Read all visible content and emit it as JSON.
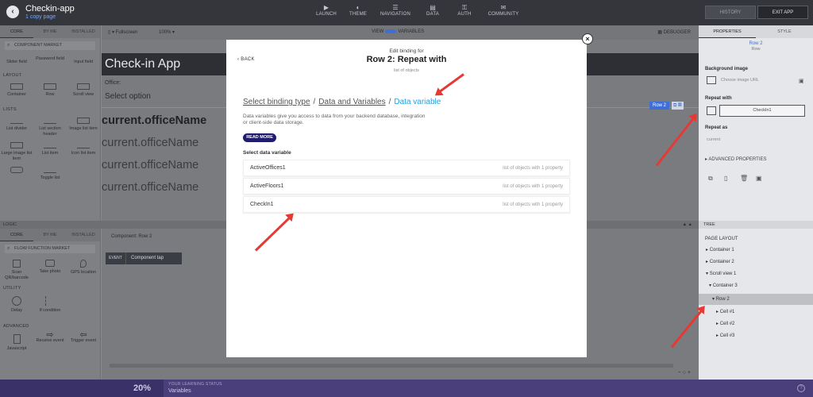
{
  "app": {
    "title": "Checkin-app",
    "subtitle": "1 copy page"
  },
  "nav": [
    {
      "icon": "launch-icon",
      "glyph": "▶",
      "label": "LAUNCH"
    },
    {
      "icon": "theme-icon",
      "glyph": "◐",
      "label": "THEME"
    },
    {
      "icon": "navigation-icon",
      "glyph": "☰",
      "label": "NAVIGATION"
    },
    {
      "icon": "data-icon",
      "glyph": "▤",
      "label": "DATA"
    },
    {
      "icon": "auth-icon",
      "glyph": "⚿",
      "label": "AUTH"
    },
    {
      "icon": "community-icon",
      "glyph": "✉",
      "label": "COMMUNITY"
    }
  ],
  "history_label": "HISTORY",
  "exit_label": "EXIT APP",
  "left_tabs": [
    "CORE",
    "BY ME",
    "INSTALLED"
  ],
  "component_market": "COMPONENT MARKET",
  "top_tiles": [
    "Slider field",
    "Password field",
    "Input field"
  ],
  "layout_label": "LAYOUT",
  "layout_tiles": [
    "Container",
    "Row",
    "Scroll view"
  ],
  "lists_label": "LISTS",
  "list_tiles": [
    "List divider",
    "List section header",
    "Image list item",
    "Large image list item",
    "List item",
    "Icon list item",
    "",
    "Toggle list"
  ],
  "toolbar": {
    "device": "Fullscreen",
    "zoom": "100%",
    "view_label": "VIEW",
    "vars_label": "VARIABLES",
    "debugger": "DEBUGGER"
  },
  "phone": {
    "header": "Check-in App",
    "office_label": "Office:",
    "select": "Select option",
    "row_tag": "Row 2"
  },
  "repeat_items": [
    "current.officeName",
    "current.officeName",
    "current.officeName",
    "current.officeName"
  ],
  "right_tabs": [
    "PROPERTIES",
    "STYLE"
  ],
  "selected": {
    "name": "Row 2",
    "type": "Row"
  },
  "bg_image": {
    "label": "Background image",
    "placeholder": "Choose image URL"
  },
  "repeat_with": {
    "label": "Repeat with",
    "value": "CheckIn1"
  },
  "repeat_as": {
    "label": "Repeat as",
    "value": "current"
  },
  "advanced": "ADVANCED PROPERTIES",
  "logic": {
    "label": "LOGIC",
    "tree_label": "TREE"
  },
  "flow_tabs": [
    "CORE",
    "BY ME",
    "INSTALLED"
  ],
  "flow_market": "FLOW FUNCTION MARKET",
  "flow_tiles": [
    "Scan QR/barcode",
    "Take photo",
    "GPS location"
  ],
  "utility_label": "UTILITY",
  "utility_tiles": [
    "Delay",
    "If condition"
  ],
  "advanced_label": "ADVANCED",
  "advanced_tiles": [
    "Javascript",
    "Receive event",
    "Trigger event"
  ],
  "flow": {
    "title": "Component: Row 2",
    "event": "EVENT",
    "event_name": "Component tap"
  },
  "tree": [
    {
      "label": "PAGE LAYOUT",
      "indent": 0
    },
    {
      "label": "Container 1",
      "indent": 1
    },
    {
      "label": "Container 2",
      "indent": 1
    },
    {
      "label": "Scroll view 1",
      "indent": 1
    },
    {
      "label": "Container 3",
      "indent": 2
    },
    {
      "label": "Row 2",
      "indent": 3,
      "hl": true
    },
    {
      "label": "Cell #1",
      "indent": 4
    },
    {
      "label": "Cell #2",
      "indent": 4
    },
    {
      "label": "Cell #3",
      "indent": 4
    }
  ],
  "status": {
    "percent": "20%",
    "title": "YOUR LEARNING STATUS",
    "subtitle": "Variables"
  },
  "modal": {
    "back": "BACK",
    "edit_label": "Edit binding for",
    "title": "Row 2: Repeat with",
    "subtitle": "list of objects",
    "crumbs": [
      "Select binding type",
      "Data and Variables",
      "Data variable"
    ],
    "description": "Data variables give you access to data from your backend database, integration or client-side data storage.",
    "read_more": "READ MORE",
    "select_label": "Select data variable",
    "variables": [
      {
        "name": "ActiveOffices1",
        "desc": "list of objects with 1 property"
      },
      {
        "name": "ActiveFloors1",
        "desc": "list of objects with 1 property"
      },
      {
        "name": "CheckIn1",
        "desc": "list of objects with 1 property"
      }
    ]
  },
  "colors": {
    "accent": "#24a0e0",
    "arrow": "#e53935",
    "read_more": "#1f1b6e",
    "status_bar": "#4a3f7a"
  }
}
